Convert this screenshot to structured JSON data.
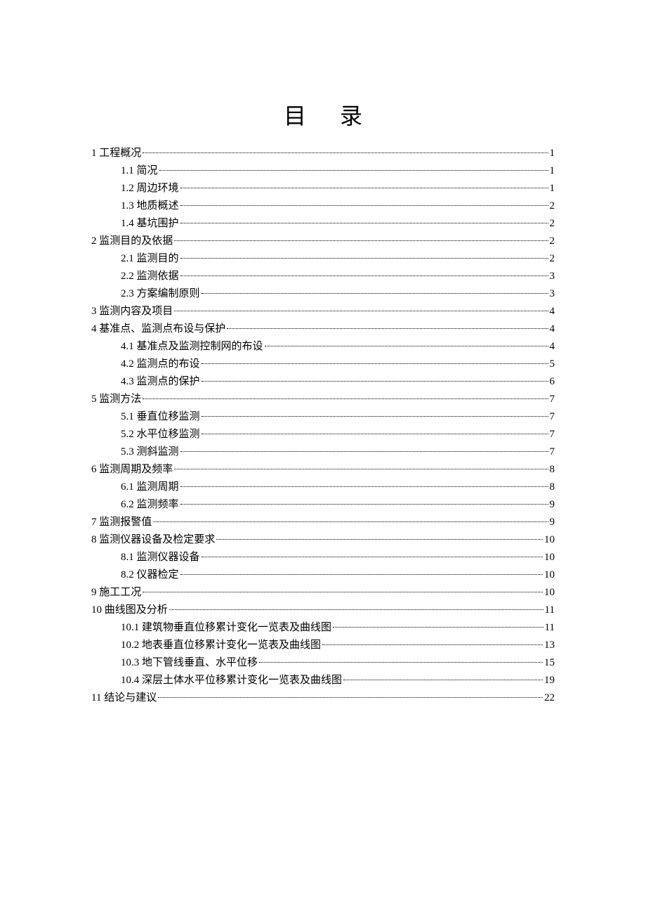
{
  "title": "目录",
  "entries": [
    {
      "level": 1,
      "text": "1 工程概况",
      "page": "1"
    },
    {
      "level": 2,
      "text": "1.1 简况",
      "page": "1"
    },
    {
      "level": 2,
      "text": "1.2 周边环境",
      "page": "1"
    },
    {
      "level": 2,
      "text": "1.3 地质概述",
      "page": "2"
    },
    {
      "level": 2,
      "text": "1.4 基坑围护",
      "page": "2"
    },
    {
      "level": 1,
      "text": "2 监测目的及依据",
      "page": "2"
    },
    {
      "level": 2,
      "text": "2.1 监测目的",
      "page": "2"
    },
    {
      "level": 2,
      "text": "2.2 监测依据",
      "page": "3"
    },
    {
      "level": 2,
      "text": "2.3 方案编制原则",
      "page": "3"
    },
    {
      "level": 1,
      "text": "3 监测内容及项目",
      "page": "4"
    },
    {
      "level": 1,
      "text": "4 基准点、监测点布设与保护",
      "page": "4"
    },
    {
      "level": 2,
      "text": "4.1 基准点及监测控制网的布设",
      "page": "4"
    },
    {
      "level": 2,
      "text": "4.2 监测点的布设",
      "page": "5"
    },
    {
      "level": 2,
      "text": "4.3 监测点的保护",
      "page": "6"
    },
    {
      "level": 1,
      "text": "5 监测方法",
      "page": "7"
    },
    {
      "level": 2,
      "text": "5.1 垂直位移监测",
      "page": "7"
    },
    {
      "level": 2,
      "text": "5.2 水平位移监测",
      "page": "7"
    },
    {
      "level": 2,
      "text": "5.3 测斜监测",
      "page": "7"
    },
    {
      "level": 1,
      "text": "6 监测周期及频率",
      "page": "8"
    },
    {
      "level": 2,
      "text": "6.1 监测周期",
      "page": "8"
    },
    {
      "level": 2,
      "text": "6.2 监测频率",
      "page": "9"
    },
    {
      "level": 1,
      "text": "7 监测报警值",
      "page": "9"
    },
    {
      "level": 1,
      "text": "8 监测仪器设备及检定要求",
      "page": "10"
    },
    {
      "level": 2,
      "text": "8.1 监测仪器设备",
      "page": "10"
    },
    {
      "level": 2,
      "text": "8.2 仪器检定",
      "page": "10"
    },
    {
      "level": 1,
      "text": "9 施工工况",
      "page": "10"
    },
    {
      "level": 1,
      "text": "10 曲线图及分析",
      "page": "11"
    },
    {
      "level": 2,
      "text": "10.1 建筑物垂直位移累计变化一览表及曲线图",
      "page": "11"
    },
    {
      "level": 2,
      "text": "10.2 地表垂直位移累计变化一览表及曲线图",
      "page": "13"
    },
    {
      "level": 2,
      "text": "10.3 地下管线垂直、水平位移",
      "page": "15"
    },
    {
      "level": 2,
      "text": "10.4 深层土体水平位移累计变化一览表及曲线图",
      "page": "19"
    },
    {
      "level": 1,
      "text": "11  结论与建议",
      "page": "22"
    }
  ]
}
